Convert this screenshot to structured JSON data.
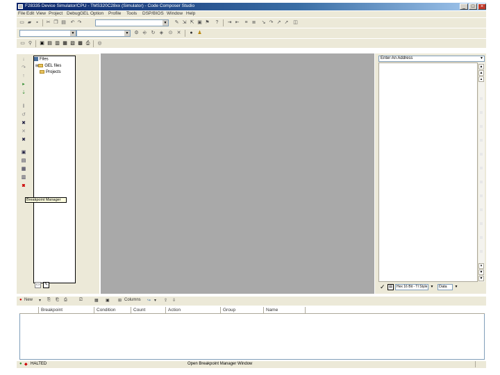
{
  "window": {
    "title": "F28335 Device Simulator/CPU - TMS320C28xx (Simulator) - Code Composer Studio",
    "controls": [
      "minimize",
      "maximize",
      "close"
    ]
  },
  "menu": [
    "File",
    "Edit",
    "View",
    "Project",
    "Debug",
    "GEL",
    "Option",
    "Profile",
    "Tools",
    "DSP/BIOS",
    "Window",
    "Help"
  ],
  "tree": {
    "root": "Files",
    "children": [
      "GEL files",
      "Projects"
    ]
  },
  "tooltip": "Breakpoint Manager",
  "memory": {
    "address_placeholder": "Enter An Address",
    "format": "Hex 16 Bit - TI Style",
    "page": "Data"
  },
  "breakpoints": {
    "toolbar": {
      "new_label": "New",
      "columns_label": "Columns"
    },
    "columns": [
      "Breakpoint",
      "Condition",
      "Count",
      "Action",
      "Group",
      "Name"
    ]
  },
  "status": {
    "state": "HALTED",
    "message": "Open Breakpoint Manager Window"
  },
  "icons": {
    "halted_indicator": "#2e8b2e",
    "accent": "#0a246a"
  }
}
